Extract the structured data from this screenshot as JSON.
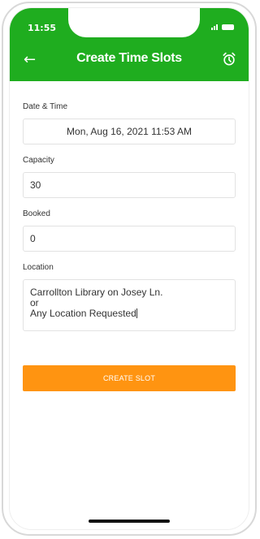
{
  "status_bar": {
    "time": "11:55"
  },
  "header": {
    "title": "Create Time Slots",
    "back_icon": "arrow-left-icon",
    "alarm_icon": "alarm-clock-icon"
  },
  "form": {
    "date_time": {
      "label": "Date & Time",
      "value": "Mon, Aug 16, 2021 11:53 AM"
    },
    "capacity": {
      "label": "Capacity",
      "value": "30"
    },
    "booked": {
      "label": "Booked",
      "value": "0"
    },
    "location": {
      "label": "Location",
      "value": "Carrollton Library on Josey Ln.\nor\nAny Location Requested"
    }
  },
  "actions": {
    "create_label": "CREATE SLOT"
  },
  "colors": {
    "appbar": "#1fad1f",
    "accent": "#ff9411"
  }
}
